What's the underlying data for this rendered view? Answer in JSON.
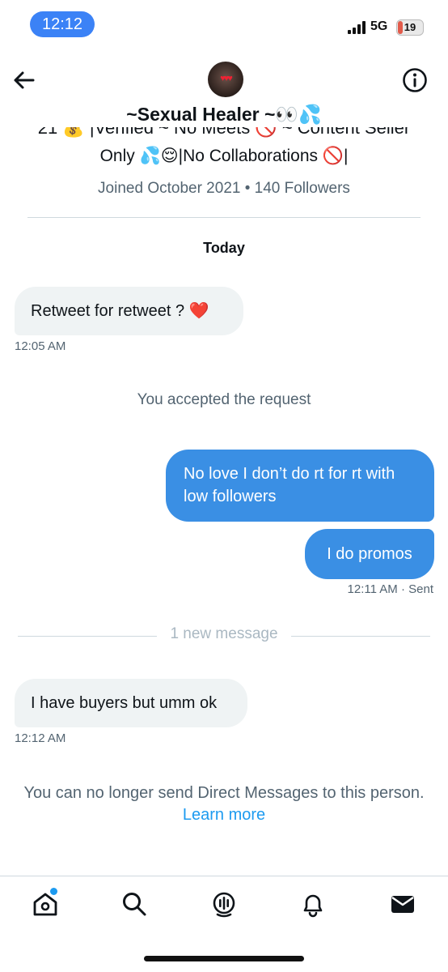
{
  "status_bar": {
    "time": "12:12",
    "network": "5Gᴾ",
    "network_label": "5G",
    "battery": "19",
    "battery_level": 0.19
  },
  "profile": {
    "name": "~Sexual Healer ~👀💦",
    "bio_line1_partial": "21 💰 |Verified ~ No Meets 🚫 ~ Content Seller",
    "bio_line2": "Only 💦😌|No Collaborations 🚫|",
    "joined": "Joined October 2021 • 140 Followers"
  },
  "conversation": {
    "day_label": "Today",
    "messages": [
      {
        "direction": "in",
        "text": "Retweet for retweet ? ❤️",
        "time": "12:05 AM"
      },
      {
        "direction": "out",
        "text": "No love I don’t do rt for rt with low followers"
      },
      {
        "direction": "out",
        "text": "I do promos",
        "time": "12:11 AM",
        "status": "· Sent"
      },
      {
        "direction": "in",
        "text": "I have buyers but umm ok",
        "time": "12:12 AM"
      }
    ],
    "request_notice": "You accepted the request",
    "new_message_divider": "1 new message",
    "blocked_notice": "You can no longer send Direct Messages to this person.",
    "learn_more": "Learn more"
  },
  "tabs": [
    {
      "name": "home",
      "icon": "home-icon",
      "has_badge": true
    },
    {
      "name": "search",
      "icon": "search-icon"
    },
    {
      "name": "spaces",
      "icon": "spaces-icon"
    },
    {
      "name": "notifications",
      "icon": "bell-icon"
    },
    {
      "name": "messages",
      "icon": "envelope-icon",
      "active": true
    }
  ],
  "colors": {
    "accent": "#1d9bf0",
    "outgoing_bubble": "#3a8fe4",
    "incoming_bubble": "#eff3f4",
    "secondary_text": "#536471",
    "time_pill": "#3b82f6",
    "battery": "#e25b4b"
  }
}
